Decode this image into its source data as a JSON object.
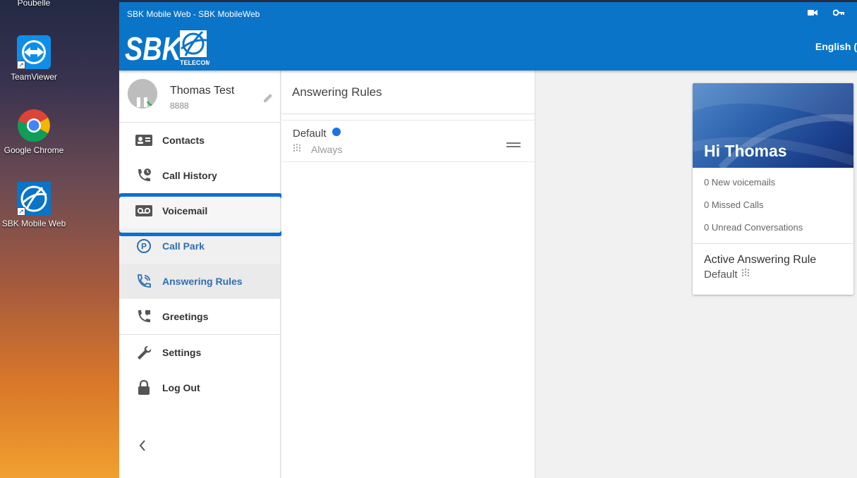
{
  "desktop": {
    "icons": [
      {
        "label": "Poubelle"
      },
      {
        "label": "TeamViewer"
      },
      {
        "label": "Google Chrome"
      },
      {
        "label": "SBK Mobile Web"
      }
    ]
  },
  "window": {
    "title": "SBK Mobile Web - SBK MobileWeb",
    "brand": "SBK",
    "brand_sub": "TELECOM",
    "language": "English (",
    "colors": {
      "primary": "#0a74c9",
      "accent": "#2e6fb3",
      "highlight": "#0a6fd4"
    }
  },
  "profile": {
    "name": "Thomas Test",
    "extension": "8888"
  },
  "sidebar": {
    "items": [
      {
        "label": "Contacts",
        "icon": "contacts-icon"
      },
      {
        "label": "Call History",
        "icon": "call-history-icon"
      },
      {
        "label": "Voicemail",
        "icon": "voicemail-icon"
      },
      {
        "label": "Call Park",
        "icon": "call-park-icon"
      },
      {
        "label": "Answering Rules",
        "icon": "answering-rules-icon",
        "active": true
      },
      {
        "label": "Greetings",
        "icon": "greetings-icon"
      },
      {
        "label": "Settings",
        "icon": "wrench-icon"
      },
      {
        "label": "Log Out",
        "icon": "lock-icon"
      }
    ]
  },
  "answering_rules": {
    "header": "Answering Rules",
    "rules": [
      {
        "name": "Default",
        "schedule": "Always",
        "active": true
      }
    ]
  },
  "summary_card": {
    "greeting": "Hi Thomas",
    "stats": [
      "0 New voicemails",
      "0 Missed Calls",
      "0 Unread Conversations"
    ],
    "active_rule_title": "Active Answering Rule",
    "active_rule_value": "Default"
  }
}
